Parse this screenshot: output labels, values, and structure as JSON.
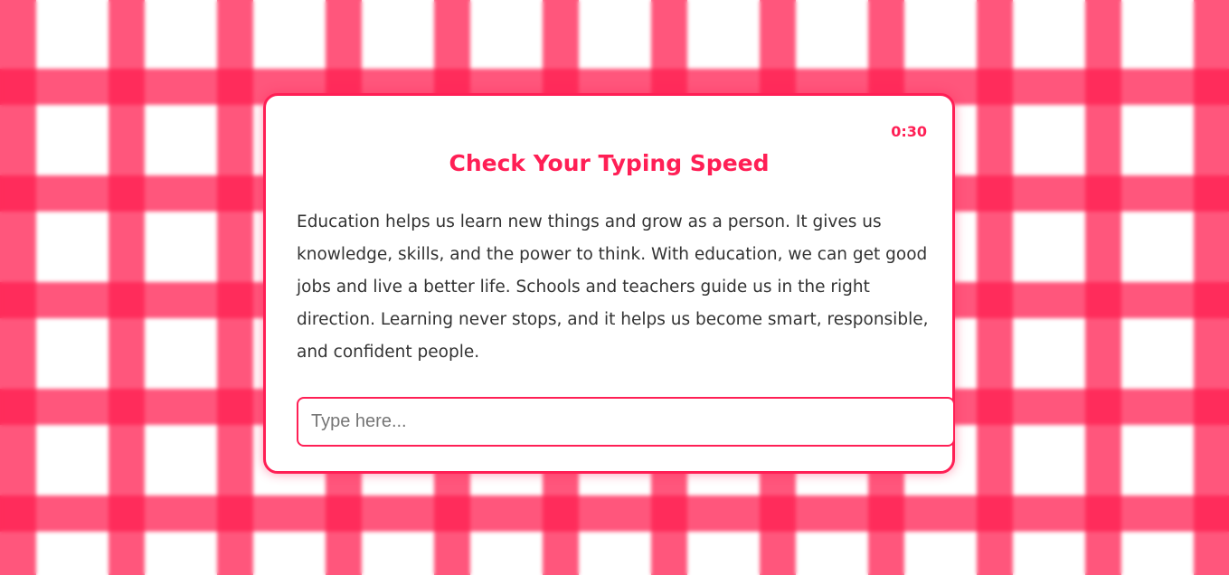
{
  "app": {
    "accent_color": "#ff1f55",
    "background_pattern": "red gingham"
  },
  "card": {
    "timer": "0:30",
    "title": "Check Your Typing Speed",
    "passage": "Education helps us learn new things and grow as a person. It gives us knowledge, skills, and the power to think. With education, we can get good jobs and live a better life. Schools and teachers guide us in the right direction. Learning never stops, and it helps us become smart, responsible, and confident people."
  },
  "input": {
    "value": "",
    "placeholder": "Type here..."
  }
}
